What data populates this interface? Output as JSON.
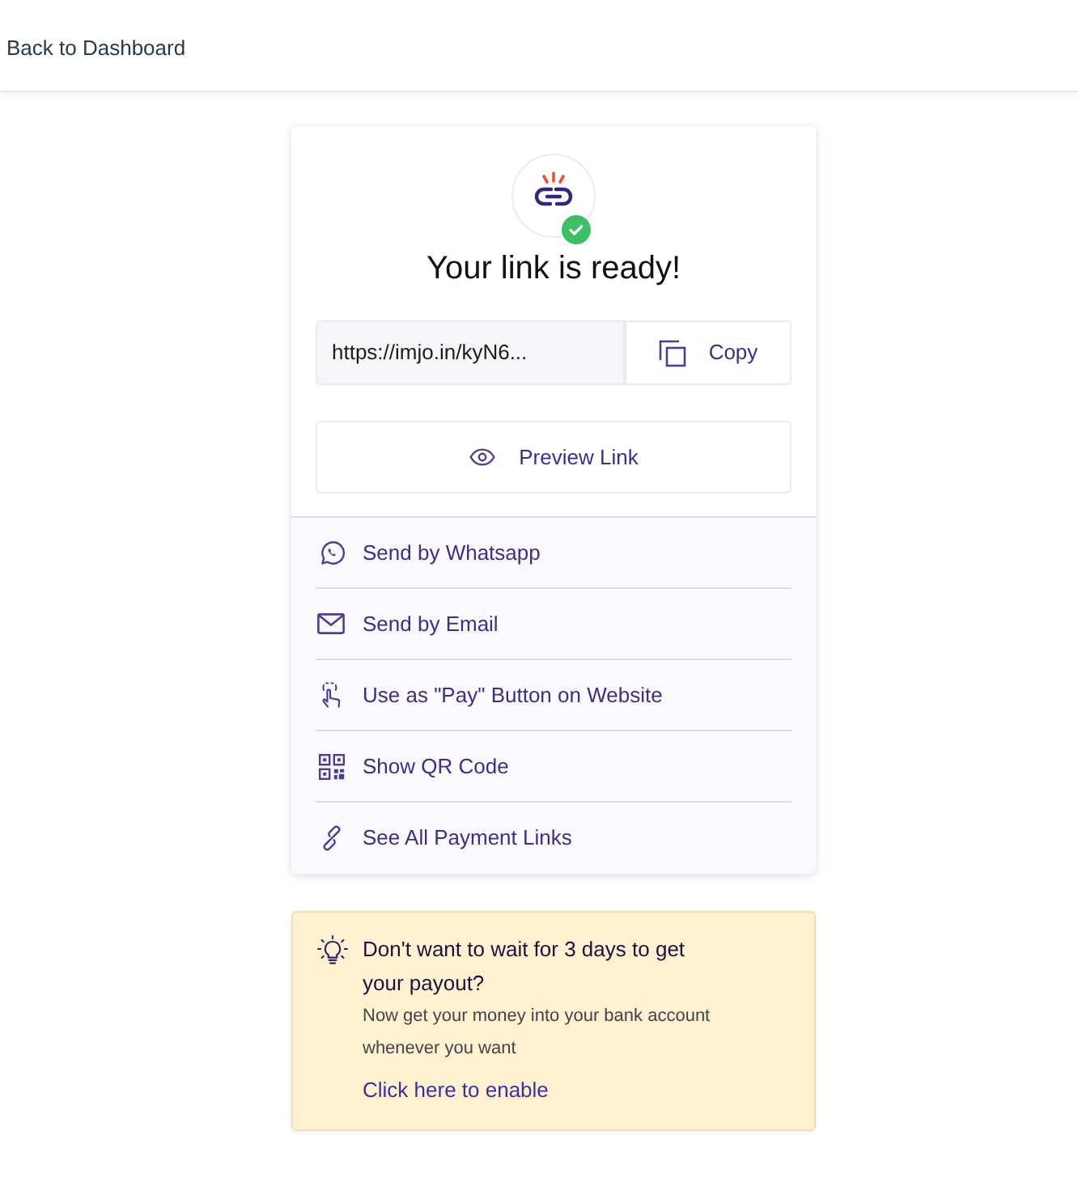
{
  "header": {
    "back_link": "Back to Dashboard"
  },
  "card": {
    "title": "Your link is ready!",
    "link_field": {
      "value": "https://imjo.in/kyN6..."
    },
    "copy_button": "Copy",
    "preview_button": "Preview Link",
    "actions": [
      {
        "kind": "whatsapp",
        "label": "Send by Whatsapp"
      },
      {
        "kind": "email",
        "label": "Send by Email"
      },
      {
        "kind": "pay_button",
        "label": "Use as \"Pay\" Button on Website"
      },
      {
        "kind": "qr",
        "label": "Show QR Code"
      },
      {
        "kind": "links",
        "label": "See All Payment Links"
      }
    ]
  },
  "promo": {
    "title": "Don't want to wait for 3 days to get your payout?",
    "text": "Now get your money into your bank account whenever you want",
    "link": "Click here to enable"
  }
}
